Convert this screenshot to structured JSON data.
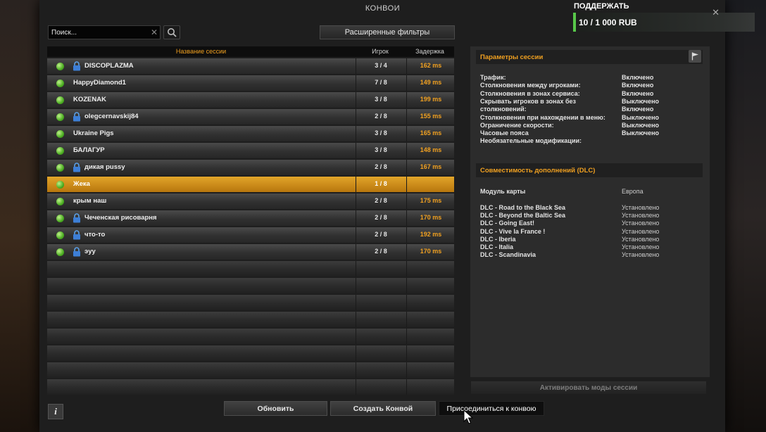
{
  "window": {
    "title": "КОНВОИ"
  },
  "search": {
    "placeholder": "Поиск..."
  },
  "toolbar": {
    "advanced_filters_label": "Расширенные фильтры"
  },
  "table": {
    "headers": {
      "name": "Название сессии",
      "players": "Игрок",
      "ping": "Задержка"
    },
    "rows": [
      {
        "name": "DISCOPLAZMA",
        "players": "3 / 4",
        "ping": "162 ms",
        "locked": true,
        "selected": false
      },
      {
        "name": "HappyDiamond1",
        "players": "7 / 8",
        "ping": "149 ms",
        "locked": false,
        "selected": false
      },
      {
        "name": "KOZENAK",
        "players": "3 / 8",
        "ping": "199 ms",
        "locked": false,
        "selected": false
      },
      {
        "name": "olegcernavskij84",
        "players": "2 / 8",
        "ping": "155 ms",
        "locked": true,
        "selected": false
      },
      {
        "name": "Ukraine Pigs",
        "players": "3 / 8",
        "ping": "165 ms",
        "locked": false,
        "selected": false
      },
      {
        "name": "БАЛАГУР",
        "players": "3 / 8",
        "ping": "148 ms",
        "locked": false,
        "selected": false
      },
      {
        "name": "дикая pussy",
        "players": "2 / 8",
        "ping": "167 ms",
        "locked": true,
        "selected": false
      },
      {
        "name": "Жека",
        "players": "1 / 8",
        "ping": "",
        "locked": false,
        "selected": true
      },
      {
        "name": "крым наш",
        "players": "2 / 8",
        "ping": "175 ms",
        "locked": false,
        "selected": false
      },
      {
        "name": "Чеченская рисоварня",
        "players": "2 / 8",
        "ping": "170 ms",
        "locked": true,
        "selected": false
      },
      {
        "name": "что-то",
        "players": "2 / 8",
        "ping": "192 ms",
        "locked": true,
        "selected": false
      },
      {
        "name": "эуу",
        "players": "2 / 8",
        "ping": "170 ms",
        "locked": true,
        "selected": false
      }
    ],
    "empty_rows": 8
  },
  "session_params": {
    "title": "Параметры сессии",
    "items": [
      {
        "label": "Трафик:",
        "value": "Включено"
      },
      {
        "label": "Столкновения между игроками:",
        "value": "Включено"
      },
      {
        "label": "Столкновения в зонах сервиса:",
        "value": "Включено"
      },
      {
        "label": "Скрывать игроков в зонах без",
        "value": "Выключено"
      },
      {
        "label": "столкновений:",
        "value": "Включено"
      },
      {
        "label": "Столкновения при нахождении в меню:",
        "value": "Выключено"
      },
      {
        "label": "Ограничение скорости:",
        "value": "Выключено"
      },
      {
        "label": "Часовые пояса",
        "value": "Выключено"
      },
      {
        "label": "Необязательные модификации:",
        "value": ""
      }
    ]
  },
  "dlc": {
    "title": "Совместимость дополнений (DLC)",
    "map_label": "Модуль карты",
    "map_value": "Европа",
    "items": [
      {
        "label": "DLC - Road to the Black Sea",
        "value": "Установлено"
      },
      {
        "label": "DLC - Beyond the Baltic Sea",
        "value": "Установлено"
      },
      {
        "label": "DLC - Going East!",
        "value": "Установлено"
      },
      {
        "label": "DLC - Vive la France !",
        "value": "Установлено"
      },
      {
        "label": "DLC - Iberia",
        "value": "Установлено"
      },
      {
        "label": "DLC - Italia",
        "value": "Установлено"
      },
      {
        "label": "DLC - Scandinavia",
        "value": "Установлено"
      }
    ]
  },
  "buttons": {
    "activate_mods": "Активировать моды сессии",
    "refresh": "Обновить",
    "create_convoy": "Создать Конвой",
    "join_convoy": "Присоединиться к конвою",
    "info": "i"
  },
  "donation": {
    "title": "ПОДДЕРЖАТЬ",
    "amount": "10 / 1 000 RUB",
    "accent_color": "#58c84a"
  },
  "colors": {
    "accent": "#f0a020",
    "selected_row": "#d49518",
    "status_online": "#4cae22"
  },
  "icons": {
    "search": "search-icon",
    "clear": "close-icon",
    "lock": "lock-icon",
    "status": "online-dot-icon",
    "flag": "flag-icon"
  }
}
